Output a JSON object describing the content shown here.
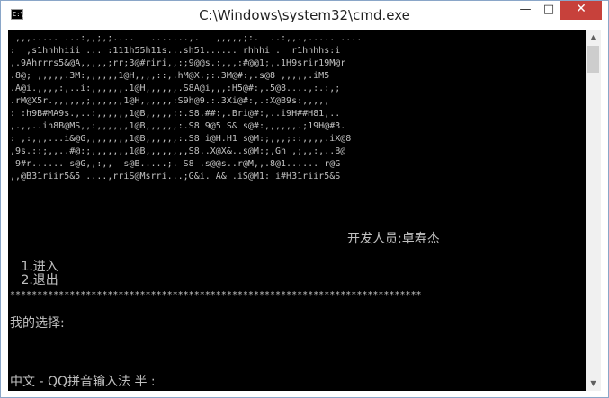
{
  "window": {
    "title": "C:\\Windows\\system32\\cmd.exe",
    "icon_text": "C:\\",
    "controls": {
      "minimize": "—",
      "maximize": "□",
      "close": "✕"
    }
  },
  "colors": {
    "console_bg": "#000000",
    "console_fg": "#c0c0c0",
    "close_bg": "#c7413b"
  },
  "console": {
    "art": [
      " ,,,..... ...:,,;,;....   .......,.   ,,,,,;:.  ..:,,.,..... ....",
      ":  ,s1hhhhiii ... :111h55h11s...sh51...... rhhhi .  r1hhhhs:i",
      ",.9Ahrrrs5&@A,,,,,;rr;3@#riri,,:;9@@s.:,,,:#@@1;,.1H9srir19M@r",
      ".8@; ,,,,,.3M:,,,,,,1@H,,,,::,.hM@X.;:.3M@#:,.s@8 ,,,,,.iM5",
      ".A@i.,,,,:,..i:,,,,,,.1@H,,,,,,.S8A@i,,,:H5@#:,.5@8....,:.:,;",
      ".rM@X5r.,,,,,,;,,,,,,1@H,,,,,,:S9h@9.:.3Xi@#:,.:X@B9s:,,,,,",
      ": :h9B#MA9s.,..:,,,,,,1@B,,,,,::.S8.##:,.Bri@#:,..i9H##H81,..",
      ",.,,..ih8B@MS,,:,,,,,,1@B,,,,,,:.S8 9@5 S& s@#:,,,,,,.;19H@#3.",
      ": ,:,,,...i&@G,,,,,,,,1@B,,,,,,:.S8 i@H.H1 s@M:;,,,;::,,,,.iX@8",
      ",9s.::;,,..#@:;,,,,,,,1@B,,,,,,,,S8..X@X&..s@M:;,Gh ,;,,:,..B@",
      " 9#r...... s@G,,:,,  s@B.....;. S8 .s@@s..r@M,,.8@1...... r@G",
      ",,@B31riir5&5 ....,rriS@Msrri...;G&i. A& .iS@M1: i#H31riir5&S"
    ],
    "developer": "开发人员:卓寿杰",
    "menu": [
      " 1.进入",
      " 2.退出"
    ],
    "divider": "****************************************************************************",
    "prompt": "我的选择:",
    "ime_status": "中文 - QQ拼音输入法 半 :"
  }
}
